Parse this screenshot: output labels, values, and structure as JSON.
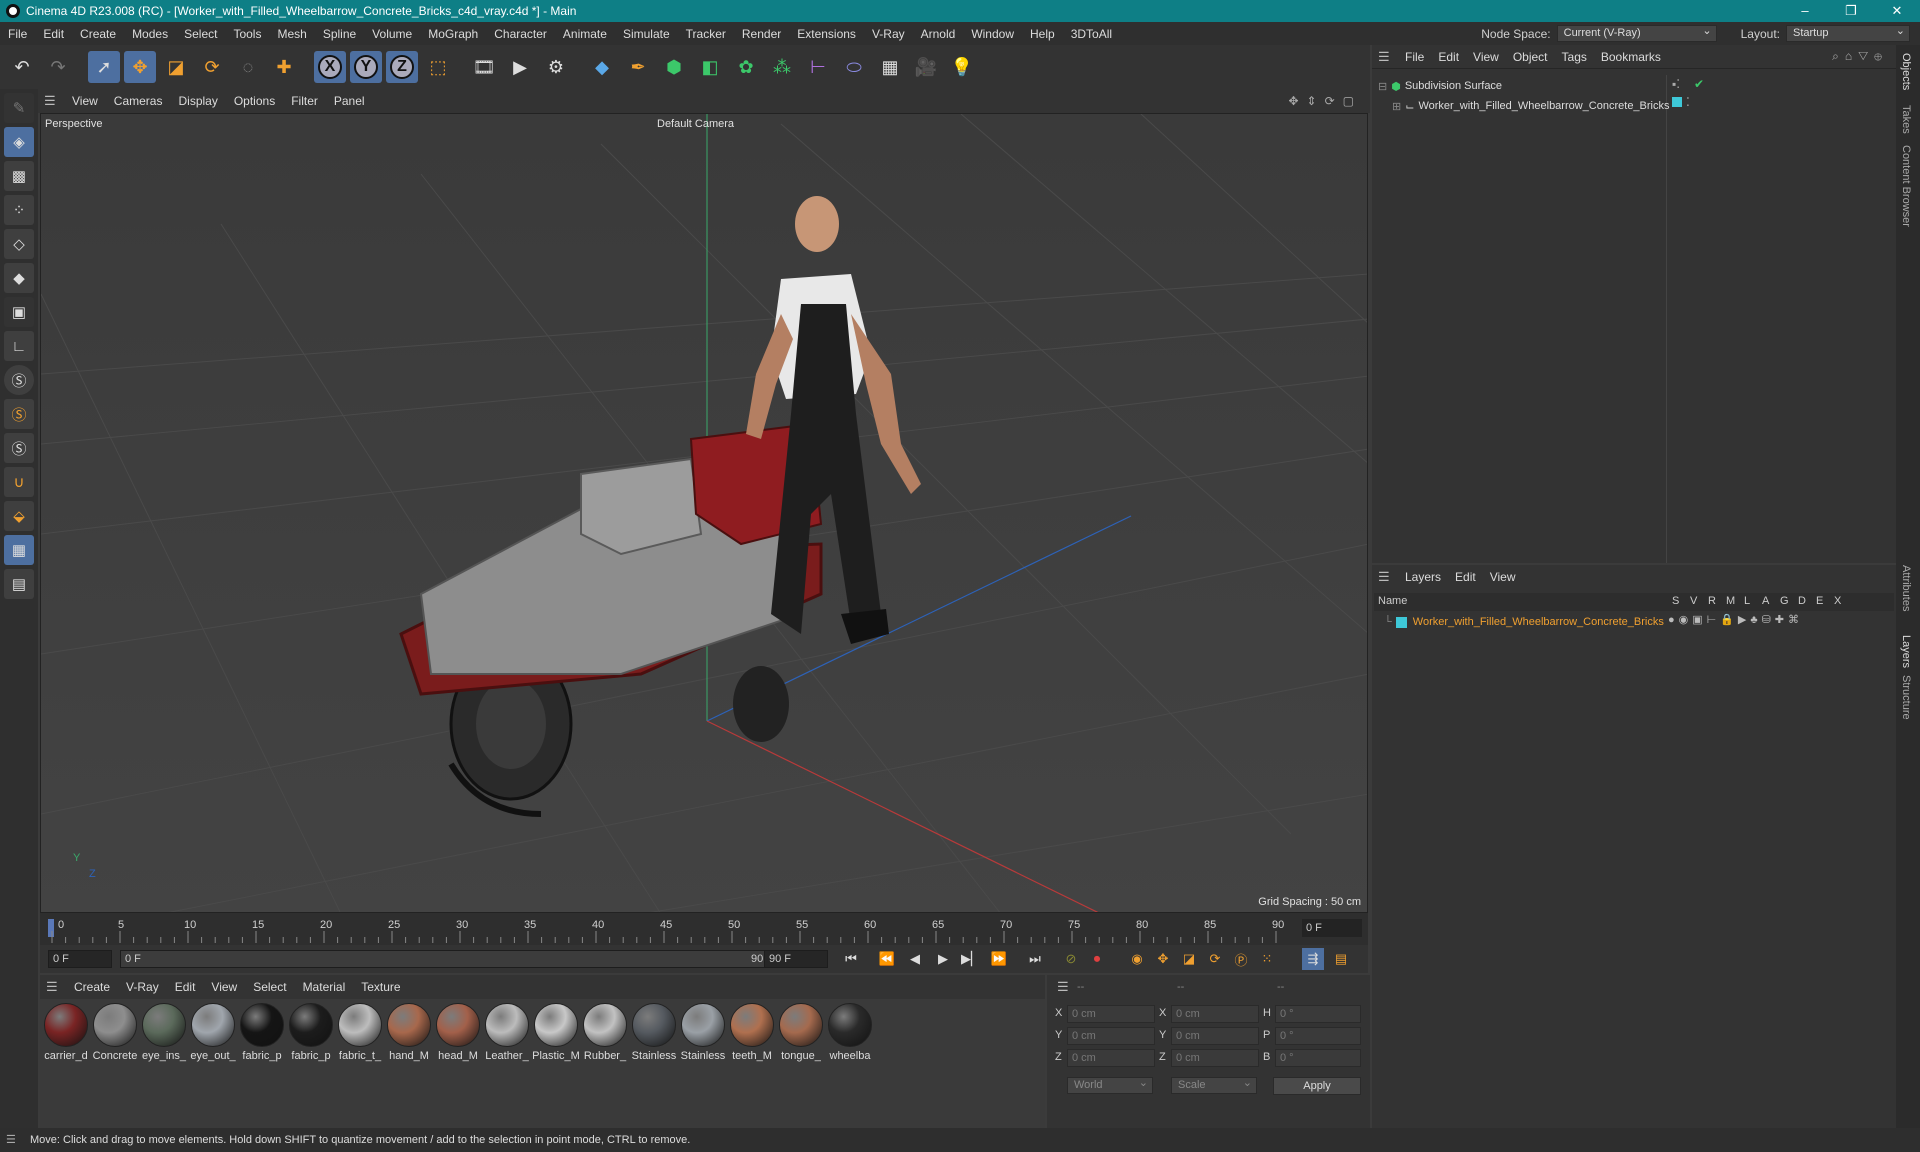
{
  "title_bar": {
    "title": "Cinema 4D R23.008 (RC) - [Worker_with_Filled_Wheelbarrow_Concrete_Bricks_c4d_vray.c4d *] - Main",
    "minimize": "–",
    "restore": "❐",
    "close": "✕"
  },
  "menubar": {
    "items": [
      "File",
      "Edit",
      "Create",
      "Modes",
      "Select",
      "Tools",
      "Mesh",
      "Spline",
      "Volume",
      "MoGraph",
      "Character",
      "Animate",
      "Simulate",
      "Tracker",
      "Render",
      "Extensions",
      "V-Ray",
      "Arnold",
      "Window",
      "Help",
      "3DToAll"
    ],
    "node_space_label": "Node Space:",
    "node_space_value": "Current (V-Ray)",
    "layout_label": "Layout:",
    "layout_value": "Startup"
  },
  "toolbar": {
    "icons": [
      "undo-icon",
      "redo-icon",
      "select-arrow-icon",
      "move-icon",
      "scale-icon",
      "rotate-icon",
      "live-selection-icon",
      "add-icon",
      "x-axis-icon",
      "y-axis-icon",
      "z-axis-icon",
      "world-coord-icon",
      "render-region-icon",
      "render-view-icon",
      "render-settings-icon",
      "cube-icon",
      "pen-icon",
      "subdivision-icon",
      "extrude-icon",
      "cloner-icon",
      "array-icon",
      "symmetry-icon",
      "deformer-icon",
      "floor-icon",
      "camera-icon",
      "light-icon"
    ],
    "xyz": [
      "X",
      "Y",
      "Z"
    ]
  },
  "viewport": {
    "menu": [
      "View",
      "Cameras",
      "Display",
      "Options",
      "Filter",
      "Panel"
    ],
    "view_name": "Perspective",
    "camera_name": "Default Camera",
    "grid_spacing": "Grid Spacing : 50 cm",
    "axis_y": "Y",
    "axis_z": "Z"
  },
  "timeline": {
    "ticks": [
      "0",
      "5",
      "10",
      "15",
      "20",
      "25",
      "30",
      "35",
      "40",
      "45",
      "50",
      "55",
      "60",
      "65",
      "70",
      "75",
      "80",
      "85",
      "90"
    ],
    "current_frame": "0 F"
  },
  "transport": {
    "start_frame": "0 F",
    "range_start": "0 F",
    "range_end": "90 F",
    "end_frame": "90 F"
  },
  "material_manager": {
    "menu": [
      "Create",
      "V-Ray",
      "Edit",
      "View",
      "Select",
      "Material",
      "Texture"
    ],
    "materials": [
      {
        "label": "carrier_d",
        "color": "#7a2424"
      },
      {
        "label": "Concrete",
        "color": "#8e8e8e"
      },
      {
        "label": "eye_ins_",
        "color": "#5b6a5b"
      },
      {
        "label": "eye_out_",
        "color": "#a0a6ad"
      },
      {
        "label": "fabric_p",
        "color": "#151515"
      },
      {
        "label": "fabric_p",
        "color": "#1c1c1c"
      },
      {
        "label": "fabric_t_",
        "color": "#bdbdbd"
      },
      {
        "label": "hand_M",
        "color": "#a8684c"
      },
      {
        "label": "head_M",
        "color": "#a3604a"
      },
      {
        "label": "Leather_",
        "color": "#bcbcbc"
      },
      {
        "label": "Plastic_M",
        "color": "#c8c8c8"
      },
      {
        "label": "Rubber_",
        "color": "#c2c2c2"
      },
      {
        "label": "Stainless",
        "color": "#555a60"
      },
      {
        "label": "Stainless",
        "color": "#9aa0a6"
      },
      {
        "label": "teeth_M",
        "color": "#b0704f"
      },
      {
        "label": "tongue_",
        "color": "#a56a4e"
      },
      {
        "label": "wheelba",
        "color": "#2a2a2a"
      }
    ]
  },
  "coordinates": {
    "headers": [
      "--",
      "--",
      "--"
    ],
    "rows": [
      {
        "a": "X",
        "av": "0 cm",
        "b": "X",
        "bv": "0 cm",
        "c": "H",
        "cv": "0 °"
      },
      {
        "a": "Y",
        "av": "0 cm",
        "b": "Y",
        "bv": "0 cm",
        "c": "P",
        "cv": "0 °"
      },
      {
        "a": "Z",
        "av": "0 cm",
        "b": "Z",
        "bv": "0 cm",
        "c": "B",
        "cv": "0 °"
      }
    ],
    "mode": "World",
    "transform": "Scale",
    "apply": "Apply"
  },
  "object_manager": {
    "menu": [
      "File",
      "Edit",
      "View",
      "Object",
      "Tags",
      "Bookmarks"
    ],
    "objects": [
      {
        "name": "Subdivision Surface"
      },
      {
        "name": "Worker_with_Filled_Wheelbarrow_Concrete_Bricks"
      }
    ]
  },
  "layer_manager": {
    "menu": [
      "Layers",
      "Edit",
      "View"
    ],
    "header_name": "Name",
    "header_flags": [
      "S",
      "V",
      "R",
      "M",
      "L",
      "A",
      "G",
      "D",
      "E",
      "X"
    ],
    "layers": [
      {
        "name": "Worker_with_Filled_Wheelbarrow_Concrete_Bricks",
        "color": "#3ec8d8"
      }
    ]
  },
  "right_tabs": [
    "Objects",
    "Takes",
    "Content Browser",
    "Attributes",
    "Layers",
    "Structure"
  ],
  "status": {
    "text": "Move: Click and drag to move elements. Hold down SHIFT to quantize movement / add to the selection in point mode, CTRL to remove."
  }
}
